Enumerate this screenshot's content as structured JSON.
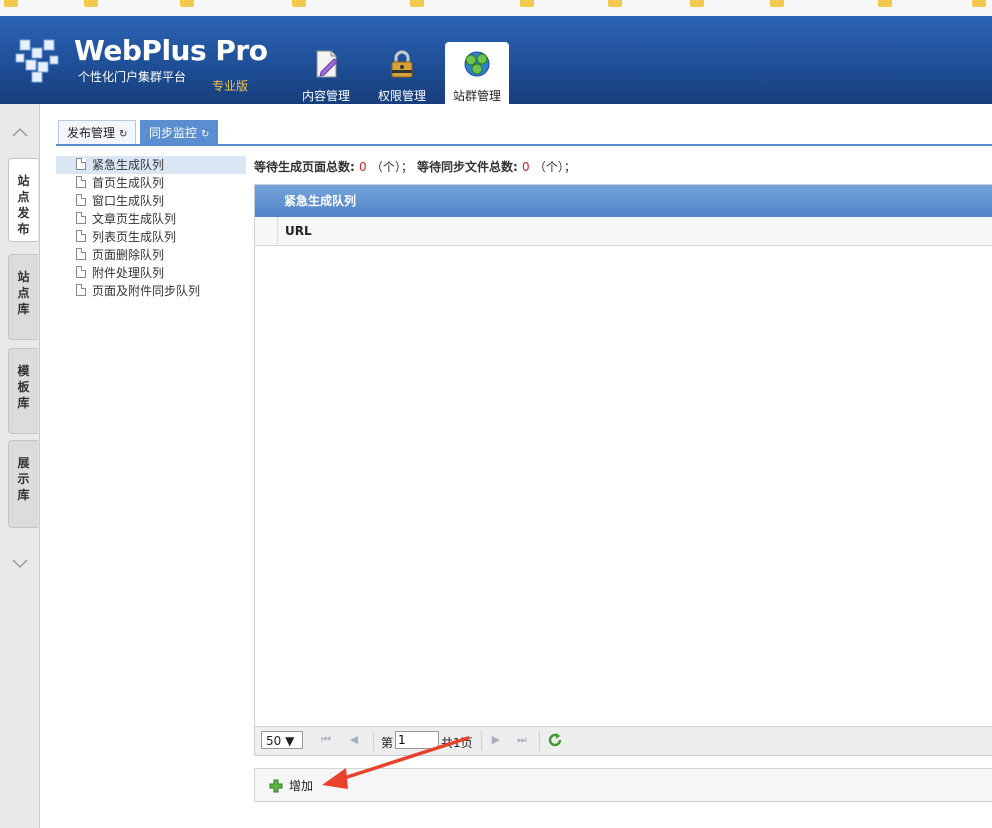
{
  "header": {
    "logo_title": "WebPlus Pro",
    "logo_sub": "个性化门户集群平台",
    "logo_edition": "专业版",
    "nav": [
      {
        "label": "内容管理",
        "icon": "document-pen-icon"
      },
      {
        "label": "权限管理",
        "icon": "padlock-icon"
      },
      {
        "label": "站群管理",
        "icon": "globe-cluster-icon",
        "active": true
      }
    ]
  },
  "side_tabs": [
    {
      "label": [
        "站",
        "点",
        "发",
        "布"
      ],
      "active": true
    },
    {
      "label": [
        "站",
        "点",
        "库"
      ]
    },
    {
      "label": [
        "模",
        "板",
        "库"
      ]
    },
    {
      "label": [
        "展",
        "示",
        "库"
      ]
    }
  ],
  "subtabs": [
    {
      "label": "发布管理",
      "active": false
    },
    {
      "label": "同步监控",
      "active": true
    }
  ],
  "tree": {
    "items": [
      "紧急生成队列",
      "首页生成队列",
      "窗口生成队列",
      "文章页生成队列",
      "列表页生成队列",
      "页面删除队列",
      "附件处理队列",
      "页面及附件同步队列"
    ],
    "selected_index": 0
  },
  "stats": {
    "pending_pages_label": "等待生成页面总数:",
    "pending_pages_value": "0",
    "unit1": "（个）；",
    "pending_files_label": "等待同步文件总数:",
    "pending_files_value": "0",
    "unit2": "（个）；"
  },
  "panel": {
    "title": "紧急生成队列",
    "columns": [
      "URL"
    ]
  },
  "pager": {
    "page_size": "50 ▼",
    "page_prefix": "第",
    "page_value": "1",
    "page_total": "共1页"
  },
  "toolbar": {
    "add_label": "增加"
  },
  "colors": {
    "header_blue": "#1f4f97",
    "accent_blue": "#5a8ed0",
    "annotation_red": "#e8412e",
    "stat_red": "#dd2222"
  }
}
